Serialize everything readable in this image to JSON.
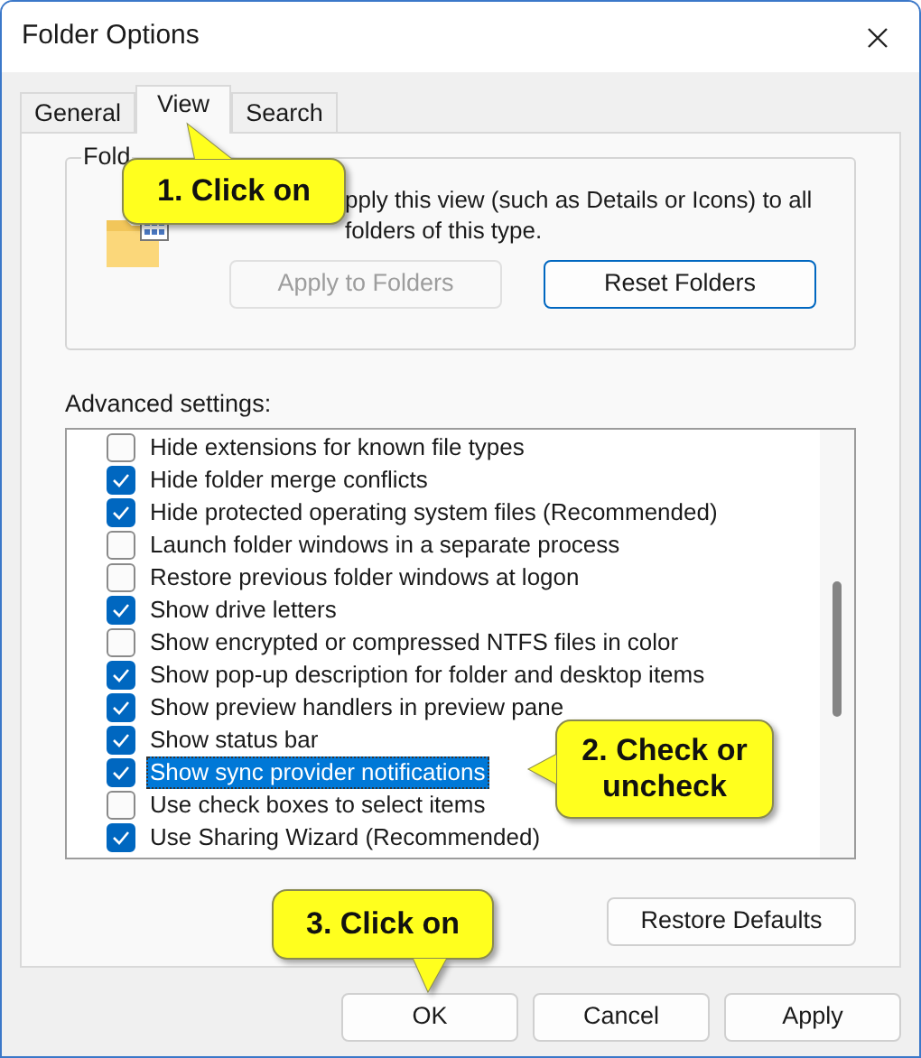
{
  "window": {
    "title": "Folder Options"
  },
  "tabs": [
    {
      "label": "General",
      "selected": false
    },
    {
      "label": "View",
      "selected": true
    },
    {
      "label": "Search",
      "selected": false
    }
  ],
  "folder_views": {
    "title": "Fold",
    "description": "pply this view (such as Details or Icons) to all folders of this type.",
    "buttons": [
      {
        "label": "Apply to Folders",
        "disabled": true
      },
      {
        "label": "Reset Folders",
        "disabled": false
      }
    ]
  },
  "advanced_settings": {
    "label": "Advanced settings:",
    "items": [
      {
        "label": "Hide extensions for known file types",
        "checked": false,
        "selected": false
      },
      {
        "label": "Hide folder merge conflicts",
        "checked": true,
        "selected": false
      },
      {
        "label": "Hide protected operating system files (Recommended)",
        "checked": true,
        "selected": false
      },
      {
        "label": "Launch folder windows in a separate process",
        "checked": false,
        "selected": false
      },
      {
        "label": "Restore previous folder windows at logon",
        "checked": false,
        "selected": false
      },
      {
        "label": "Show drive letters",
        "checked": true,
        "selected": false
      },
      {
        "label": "Show encrypted or compressed NTFS files in color",
        "checked": false,
        "selected": false
      },
      {
        "label": "Show pop-up description for folder and desktop items",
        "checked": true,
        "selected": false
      },
      {
        "label": "Show preview handlers in preview pane",
        "checked": true,
        "selected": false
      },
      {
        "label": "Show status bar",
        "checked": true,
        "selected": false
      },
      {
        "label": "Show sync provider notifications",
        "checked": true,
        "selected": true
      },
      {
        "label": "Use check boxes to select items",
        "checked": false,
        "selected": false
      },
      {
        "label": "Use Sharing Wizard (Recommended)",
        "checked": true,
        "selected": false
      }
    ],
    "restore_button": "Restore Defaults"
  },
  "footer_buttons": [
    "OK",
    "Cancel",
    "Apply"
  ],
  "callouts": [
    {
      "text": "1. Click on"
    },
    {
      "text": "2. Check or uncheck"
    },
    {
      "text": "3. Click on"
    }
  ]
}
